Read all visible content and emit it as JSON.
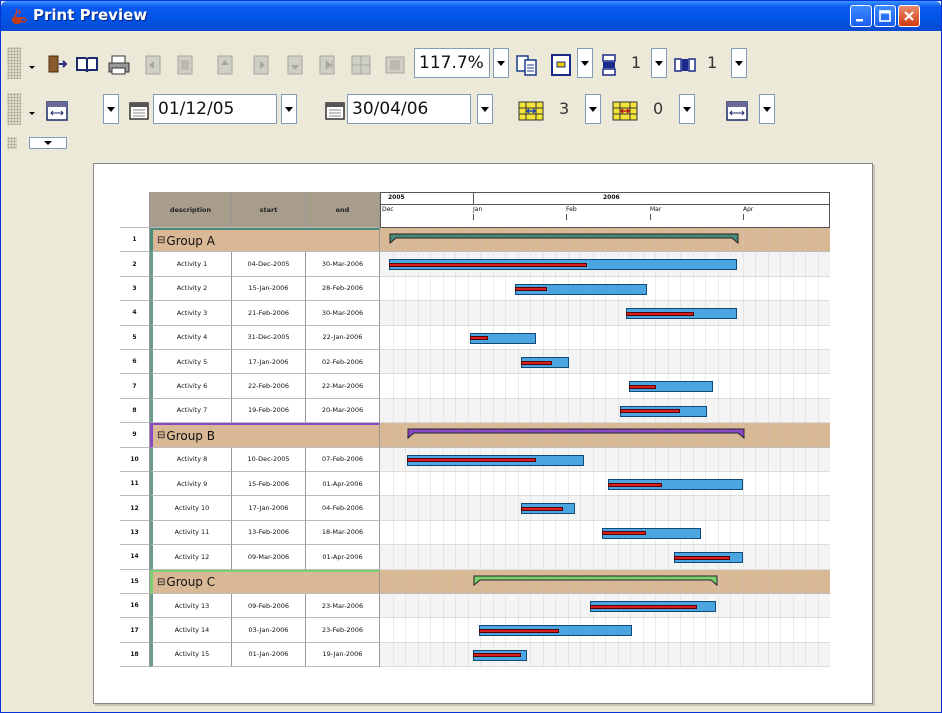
{
  "window": {
    "title": "Print Preview"
  },
  "toolbar1": {
    "zoom": "117.7%",
    "pages_down": "1",
    "pages_across": "1"
  },
  "toolbar2": {
    "start_date": "01/12/05",
    "end_date": "30/04/06",
    "spinner_a": "3",
    "spinner_b": "0"
  },
  "gantt": {
    "headers": {
      "description": "description",
      "start": "start",
      "end": "end"
    },
    "years": [
      "2005",
      "2006"
    ],
    "months": [
      "Dec",
      "Jan",
      "Feb",
      "Mar",
      "Apr"
    ],
    "rows": [
      {
        "num": "1",
        "type": "group",
        "label": "Group A",
        "color": "#4a8a78"
      },
      {
        "num": "2",
        "label": "Activity 1",
        "start": "04-Dec-2005",
        "end": "30-Mar-2006"
      },
      {
        "num": "3",
        "label": "Activity 2",
        "start": "15-Jan-2006",
        "end": "28-Feb-2006"
      },
      {
        "num": "4",
        "label": "Activity 3",
        "start": "21-Feb-2006",
        "end": "30-Mar-2006"
      },
      {
        "num": "5",
        "label": "Activity 4",
        "start": "31-Dec-2005",
        "end": "22-Jan-2006"
      },
      {
        "num": "6",
        "label": "Activity 5",
        "start": "17-Jan-2006",
        "end": "02-Feb-2006"
      },
      {
        "num": "7",
        "label": "Activity 6",
        "start": "22-Feb-2006",
        "end": "22-Mar-2006"
      },
      {
        "num": "8",
        "label": "Activity 7",
        "start": "19-Feb-2006",
        "end": "20-Mar-2006"
      },
      {
        "num": "9",
        "type": "group",
        "label": "Group B",
        "color": "#8a4ac8"
      },
      {
        "num": "10",
        "label": "Activity 8",
        "start": "10-Dec-2005",
        "end": "07-Feb-2006"
      },
      {
        "num": "11",
        "label": "Activity 9",
        "start": "15-Feb-2006",
        "end": "01-Apr-2006"
      },
      {
        "num": "12",
        "label": "Activity 10",
        "start": "17-Jan-2006",
        "end": "04-Feb-2006"
      },
      {
        "num": "13",
        "label": "Activity 11",
        "start": "13-Feb-2006",
        "end": "18-Mar-2006"
      },
      {
        "num": "14",
        "label": "Activity 12",
        "start": "09-Mar-2006",
        "end": "01-Apr-2006"
      },
      {
        "num": "15",
        "type": "group",
        "label": "Group C",
        "color": "#7ad070"
      },
      {
        "num": "16",
        "label": "Activity 13",
        "start": "09-Feb-2006",
        "end": "23-Mar-2006"
      },
      {
        "num": "17",
        "label": "Activity 14",
        "start": "03-Jan-2006",
        "end": "23-Feb-2006"
      },
      {
        "num": "18",
        "label": "Activity 15",
        "start": "01-Jan-2006",
        "end": "19-Jan-2006"
      }
    ]
  }
}
